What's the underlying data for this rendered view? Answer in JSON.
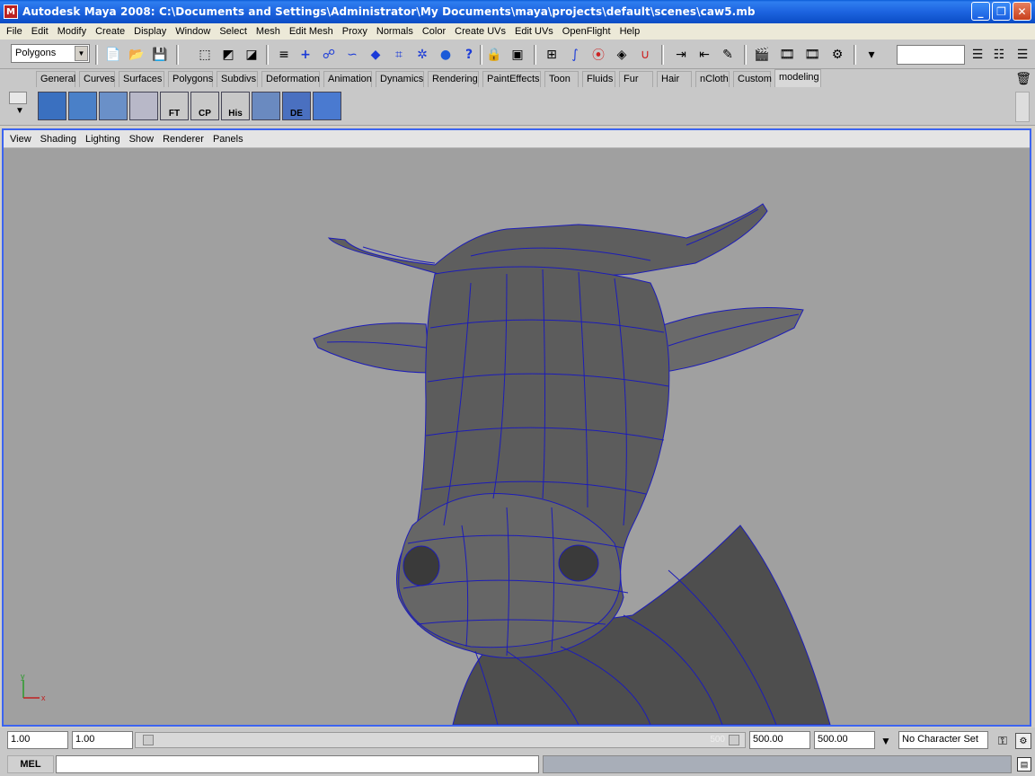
{
  "window": {
    "title": "Autodesk Maya 2008: C:\\Documents and Settings\\Administrator\\My Documents\\maya\\projects\\default\\scenes\\caw5.mb",
    "app_icon": "maya-icon",
    "controls": [
      "minimize-icon",
      "maximize-icon",
      "close-icon"
    ]
  },
  "menu": [
    "File",
    "Edit",
    "Modify",
    "Create",
    "Display",
    "Window",
    "Select",
    "Mesh",
    "Edit Mesh",
    "Proxy",
    "Normals",
    "Color",
    "Create UVs",
    "Edit UVs",
    "OpenFlight",
    "Help"
  ],
  "statusline": {
    "mode": "Polygons"
  },
  "shelf": {
    "tabs": [
      "General",
      "Curves",
      "Surfaces",
      "Polygons",
      "Subdivs",
      "Deformation",
      "Animation",
      "Dynamics",
      "Rendering",
      "PaintEffects",
      "Toon",
      "Fluids",
      "Fur",
      "Hair",
      "nCloth",
      "Custom",
      "modeling"
    ],
    "active_tab": "modeling",
    "buttons": [
      "",
      "",
      "",
      "",
      "FT",
      "CP",
      "His",
      "",
      "DE",
      ""
    ]
  },
  "viewport": {
    "panel_menu": [
      "View",
      "Shading",
      "Lighting",
      "Show",
      "Renderer",
      "Panels"
    ],
    "axis": {
      "y": "y",
      "x": "x"
    }
  },
  "timebar": {
    "start_time": "1.00",
    "current_time": "1.00",
    "slider_end_label": "500",
    "range_end": "500.00",
    "end_time": "500.00",
    "character_set": "No Character Set"
  },
  "cmdline": {
    "label": "MEL"
  }
}
